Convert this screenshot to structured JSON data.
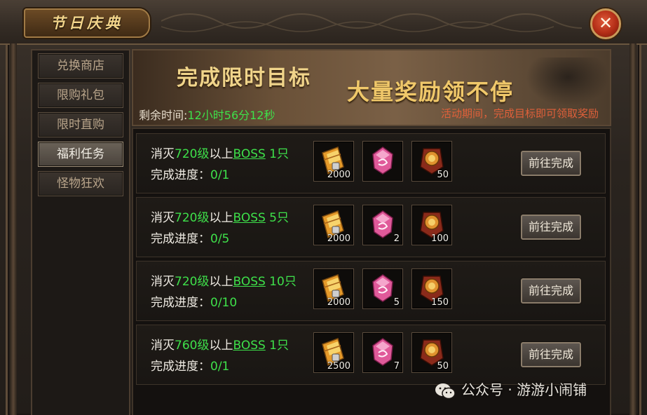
{
  "window": {
    "title": "节日庆典"
  },
  "sidebar": {
    "items": [
      {
        "label": "兑换商店",
        "active": false
      },
      {
        "label": "限购礼包",
        "active": false
      },
      {
        "label": "限时直购",
        "active": false
      },
      {
        "label": "福利任务",
        "active": true
      },
      {
        "label": "怪物狂欢",
        "active": false
      }
    ]
  },
  "banner": {
    "headline": "完成限时目标",
    "headline2": "大量奖励领不停",
    "timer_label": "剩余时间:",
    "timer_value": "12小时56分12秒",
    "note": "活动期间，完成目标即可领取奖励"
  },
  "tasks": [
    {
      "prefix": "消灭",
      "level": "720级",
      "mid": "以上",
      "boss": "BOSS",
      "count": " 1只",
      "progress_label": "完成进度：",
      "progress": "0/1",
      "rewards": [
        {
          "icon": "gold-ticket-icon",
          "count": "2000"
        },
        {
          "icon": "pink-crystal-icon",
          "count": ""
        },
        {
          "icon": "bronze-medal-icon",
          "count": "50"
        }
      ],
      "button": "前往完成"
    },
    {
      "prefix": "消灭",
      "level": "720级",
      "mid": "以上",
      "boss": "BOSS",
      "count": " 5只",
      "progress_label": "完成进度：",
      "progress": "0/5",
      "rewards": [
        {
          "icon": "gold-ticket-icon",
          "count": "2000"
        },
        {
          "icon": "pink-crystal-icon",
          "count": "2"
        },
        {
          "icon": "bronze-medal-icon",
          "count": "100"
        }
      ],
      "button": "前往完成"
    },
    {
      "prefix": "消灭",
      "level": "720级",
      "mid": "以上",
      "boss": "BOSS",
      "count": " 10只",
      "progress_label": "完成进度：",
      "progress": "0/10",
      "rewards": [
        {
          "icon": "gold-ticket-icon",
          "count": "2000"
        },
        {
          "icon": "pink-crystal-icon",
          "count": "5"
        },
        {
          "icon": "bronze-medal-icon",
          "count": "150"
        }
      ],
      "button": "前往完成"
    },
    {
      "prefix": "消灭",
      "level": "760级",
      "mid": "以上",
      "boss": "BOSS",
      "count": " 1只",
      "progress_label": "完成进度：",
      "progress": "0/1",
      "rewards": [
        {
          "icon": "gold-ticket-icon",
          "count": "2500"
        },
        {
          "icon": "pink-crystal-icon",
          "count": "7"
        },
        {
          "icon": "bronze-medal-icon",
          "count": "50"
        }
      ],
      "button": "前往完成"
    }
  ],
  "watermark": {
    "text": "公众号 · 游游小闹铺"
  },
  "colors": {
    "accent_green": "#3ee04a",
    "note_orange": "#e0603a",
    "title_gold": "#f2d48a"
  }
}
